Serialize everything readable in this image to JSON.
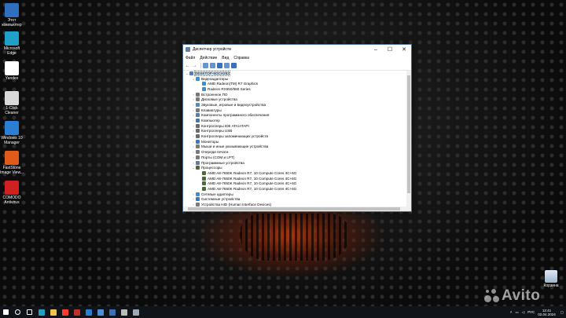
{
  "desktop_icons": [
    {
      "label": "Этот компьютер",
      "icon": "computer-icon",
      "color": "#2f6fbf"
    },
    {
      "label": "Microsoft Edge",
      "icon": "edge-icon",
      "color": "#1fa0c9"
    },
    {
      "label": "Yandex",
      "icon": "yandex-icon",
      "color": "#ffffff"
    },
    {
      "label": "1-Click Cleaner",
      "icon": "cleaner-icon",
      "color": "#d9d9d9"
    },
    {
      "label": "Windows 10 Manager",
      "icon": "win10-manager-icon",
      "color": "#2a7fd4"
    },
    {
      "label": "FastStone Image View...",
      "icon": "faststone-icon",
      "color": "#e05a1a"
    },
    {
      "label": "COMODO Antivirus",
      "icon": "comodo-icon",
      "color": "#d02020"
    }
  ],
  "recycle_bin": {
    "label": "Корзина"
  },
  "window": {
    "title": "Диспетчер устройств",
    "menu": [
      "Файл",
      "Действие",
      "Вид",
      "Справка"
    ],
    "tree": [
      {
        "label": "DESKTOP-9OCH253",
        "level": 0,
        "expanded": true,
        "selected": true,
        "icon_color": "#4c7fbf"
      },
      {
        "label": "Видеоадаптеры",
        "level": 1,
        "expanded": true,
        "icon_color": "#3a8fd0"
      },
      {
        "label": "AMD Radeon(TM) R7 Graphics",
        "level": 2,
        "icon_color": "#3a8fd0"
      },
      {
        "label": "Radeon RX550/550 Series",
        "level": 2,
        "icon_color": "#3a8fd0"
      },
      {
        "label": "Встроенное ПО",
        "level": 1,
        "icon_color": "#7a7a7a"
      },
      {
        "label": "Дисковые устройства",
        "level": 1,
        "icon_color": "#7a7a7a"
      },
      {
        "label": "Звуковые, игровые и видеоустройства",
        "level": 1,
        "icon_color": "#4a90c8"
      },
      {
        "label": "Клавиатуры",
        "level": 1,
        "icon_color": "#7a7a7a"
      },
      {
        "label": "Компоненты программного обеспечения",
        "level": 1,
        "icon_color": "#5c7ea3"
      },
      {
        "label": "Компьютер",
        "level": 1,
        "icon_color": "#3a78c0"
      },
      {
        "label": "Контроллеры IDE ATA/ATAPI",
        "level": 1,
        "icon_color": "#6b6b6b"
      },
      {
        "label": "Контроллеры USB",
        "level": 1,
        "icon_color": "#6b6b6b"
      },
      {
        "label": "Контроллеры запоминающих устройств",
        "level": 1,
        "icon_color": "#6b6b6b"
      },
      {
        "label": "Мониторы",
        "level": 1,
        "icon_color": "#3a78c0"
      },
      {
        "label": "Мыши и иные указывающие устройства",
        "level": 1,
        "icon_color": "#7a7a7a"
      },
      {
        "label": "Очереди печати",
        "level": 1,
        "icon_color": "#7a7a7a"
      },
      {
        "label": "Порты (COM и LPT)",
        "level": 1,
        "icon_color": "#7a7a7a"
      },
      {
        "label": "Программные устройства",
        "level": 1,
        "icon_color": "#5c7ea3"
      },
      {
        "label": "Процессоры",
        "level": 1,
        "expanded": true,
        "icon_color": "#4a6a3a"
      },
      {
        "label": "AMD A8-7650K Radeon R7, 10 Compute Cores 4C+6G",
        "level": 2,
        "icon_color": "#4a6a3a"
      },
      {
        "label": "AMD A8-7650K Radeon R7, 10 Compute Cores 4C+6G",
        "level": 2,
        "icon_color": "#4a6a3a"
      },
      {
        "label": "AMD A8-7650K Radeon R7, 10 Compute Cores 4C+6G",
        "level": 2,
        "icon_color": "#4a6a3a"
      },
      {
        "label": "AMD A8-7650K Radeon R7, 10 Compute Cores 4C+6G",
        "level": 2,
        "icon_color": "#4a6a3a"
      },
      {
        "label": "Сетевые адаптеры",
        "level": 1,
        "icon_color": "#3a8fd0"
      },
      {
        "label": "Системные устройства",
        "level": 1,
        "icon_color": "#3a78c0"
      },
      {
        "label": "Устройства HID (Human Interface Devices)",
        "level": 1,
        "icon_color": "#7a7a7a"
      }
    ]
  },
  "taskbar": {
    "apps": [
      {
        "icon": "windows-start-icon",
        "color": "#ffffff"
      },
      {
        "icon": "search-icon",
        "color": "#ffffff"
      },
      {
        "icon": "task-view-icon",
        "color": "#ffffff"
      },
      {
        "icon": "edge-icon",
        "color": "#1fa0c9"
      },
      {
        "icon": "folder-icon",
        "color": "#f2c14e"
      },
      {
        "icon": "yandex-icon",
        "color": "#ff3b30"
      },
      {
        "icon": "winrar-icon",
        "color": "#c0302a"
      },
      {
        "icon": "win10-manager-icon",
        "color": "#2a7fd4"
      },
      {
        "icon": "app-icon",
        "color": "#4a8fd8"
      },
      {
        "icon": "app2-icon",
        "color": "#3c6fb5"
      },
      {
        "icon": "settings-icon",
        "color": "#bbbbbb"
      },
      {
        "icon": "device-manager-icon",
        "color": "#9ab"
      }
    ],
    "lang": "РУС",
    "time": "12:41",
    "date": "02.04.2024"
  },
  "watermark": "Avito"
}
